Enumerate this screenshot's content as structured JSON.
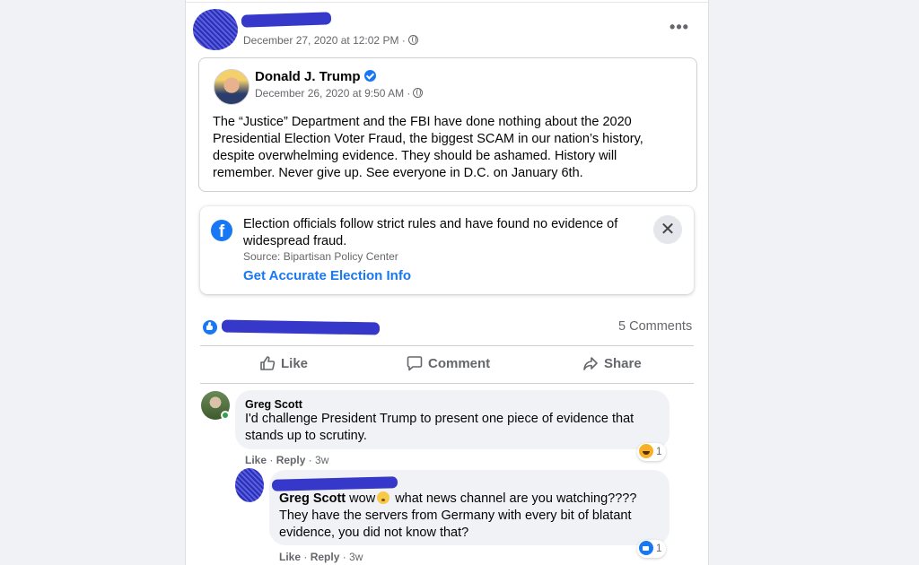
{
  "post": {
    "timestamp": "December 27, 2020 at 12:02 PM ·",
    "more_label": "•••"
  },
  "shared_post": {
    "author": "Donald J. Trump",
    "timestamp": "December 26, 2020 at 9:50 AM ·",
    "body": "The “Justice” Department and the FBI have done nothing about the 2020 Presidential Election Voter Fraud, the biggest SCAM in our nation’s history, despite overwhelming evidence. They should be ashamed. History will remember. Never give up. See everyone in D.C. on January 6th."
  },
  "fact_check": {
    "icon": "f",
    "text": "Election officials follow strict rules and have found no evidence of widespread fraud.",
    "source": "Source: Bipartisan Policy Center",
    "link": "Get Accurate Election Info",
    "close": "✕"
  },
  "stats": {
    "comments": "5 Comments"
  },
  "actions": {
    "like": "Like",
    "comment": "Comment",
    "share": "Share"
  },
  "comments": [
    {
      "name": "Greg Scott",
      "text": "I'd challenge President Trump to present one piece of evidence that stands up to scrutiny.",
      "like": "Like",
      "reply": "Reply",
      "age": "· 3w",
      "reaction_count": "1"
    },
    {
      "mention": "Greg Scott",
      "text_a": "wow",
      "text_b": "what news channel are you watching???? They have the servers from Germany with every bit of blatant evidence, you did not know that?",
      "like": "Like",
      "reply": "Reply",
      "age": "· 3w",
      "reaction_count": "1"
    }
  ],
  "colors": {
    "accent": "#1877f2",
    "redaction": "#3538c8",
    "online": "#31a24c"
  }
}
